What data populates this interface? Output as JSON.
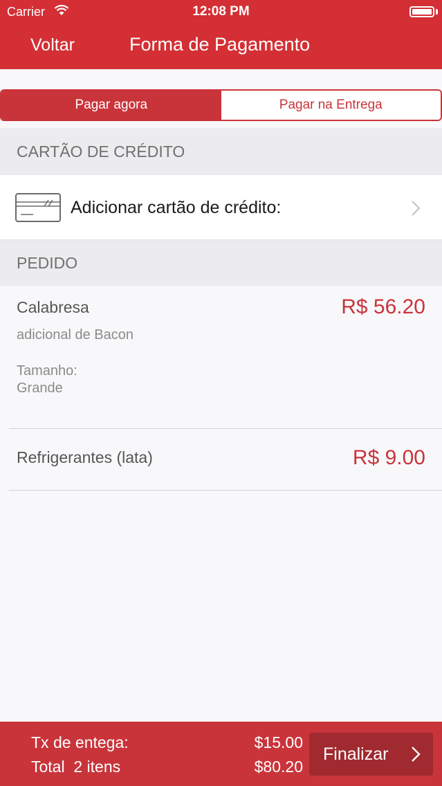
{
  "status_bar": {
    "carrier": "Carrier",
    "time": "12:08 PM"
  },
  "nav": {
    "back_label": "Voltar",
    "title": "Forma de Pagamento"
  },
  "segment": {
    "options": [
      "Pagar agora",
      "Pagar na Entrega"
    ],
    "selected": "Pagar agora"
  },
  "sections": {
    "card_header": "CARTÃO DE CRÉDITO",
    "order_header": "PEDIDO"
  },
  "card": {
    "add_label": "Adicionar cartão de crédito:"
  },
  "order": {
    "items": [
      {
        "name": "Calabresa",
        "price": "R$ 56.20",
        "extra": "adicional de Bacon",
        "size_label": "Tamanho:",
        "size_value": "Grande"
      },
      {
        "name": "Refrigerantes (lata)",
        "price": "R$ 9.00"
      }
    ]
  },
  "footer": {
    "delivery_label": "Tx de entega:",
    "delivery_value": "$15.00",
    "total_label": "Total  2 itens",
    "total_value": "$80.20",
    "finalize_label": "Finalizar"
  },
  "colors": {
    "brand": "#d32f34",
    "accent": "#c9343a",
    "finalize_bg": "#a02a2f"
  }
}
